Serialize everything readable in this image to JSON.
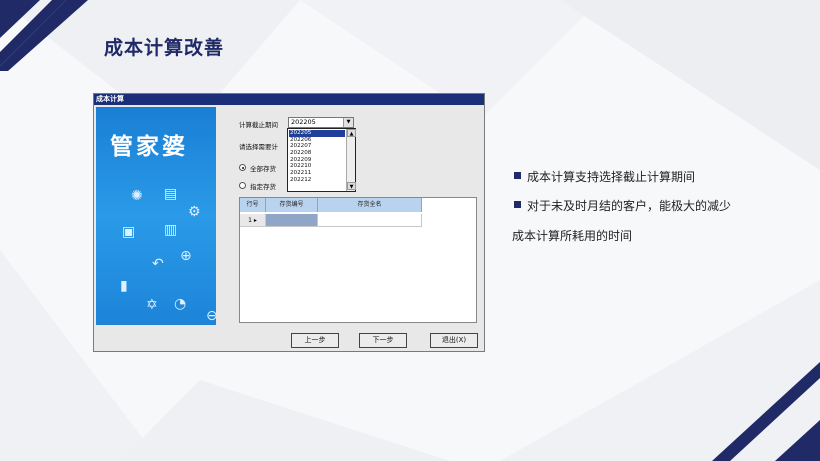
{
  "slide": {
    "title": "成本计算改善"
  },
  "window": {
    "title": "成本计算",
    "brand": "管家婆",
    "period_label": "计算截止期间",
    "period_value": "202205",
    "filter_label": "请选择需要计",
    "radio_all": "全部存货",
    "radio_specific": "指定存货",
    "period_options": [
      "202205",
      "202206",
      "202207",
      "202208",
      "202209",
      "202210",
      "202211",
      "202212"
    ],
    "table": {
      "headers": [
        "行号",
        "存货编号",
        "存货全名"
      ],
      "rows": [
        [
          "1",
          "",
          ""
        ]
      ]
    },
    "buttons": {
      "prev": "上一步",
      "next": "下一步",
      "exit": "退出(X)"
    }
  },
  "bullets": {
    "item1": "成本计算支持选择截止计算期间",
    "item2": "对于未及时月结的客户，能极大的减少",
    "item2_cont": "成本计算所耗用的时间"
  },
  "colors": {
    "accent": "#1f2a66",
    "banner": "#1a7fd4",
    "selection": "#1f3f9a"
  }
}
